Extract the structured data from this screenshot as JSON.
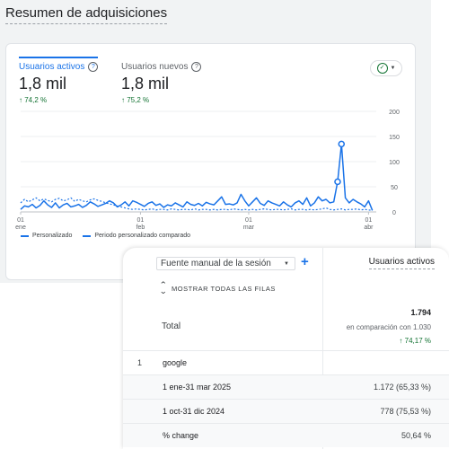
{
  "page_title": "Resumen de adquisiciones",
  "metrics": [
    {
      "label": "Usuarios activos",
      "value": "1,8 mil",
      "change": "↑ 74,2 %"
    },
    {
      "label": "Usuarios nuevos",
      "value": "1,8 mil",
      "change": "↑ 75,2 %"
    }
  ],
  "chart_data": {
    "type": "line",
    "x_tick_labels": [
      [
        "01",
        "ene"
      ],
      [
        "01",
        "feb"
      ],
      [
        "01",
        "mar"
      ],
      [
        "01",
        "abr"
      ]
    ],
    "x_tick_positions": [
      0,
      31,
      59,
      90
    ],
    "y_ticks": [
      0,
      50,
      100,
      150,
      200
    ],
    "ylim": [
      0,
      200
    ],
    "xlim": [
      0,
      92
    ],
    "grid": true,
    "legend_position": "bottom-left",
    "series": [
      {
        "name": "Personalizado",
        "style": "solid",
        "color": "#1a73e8",
        "values": [
          5,
          12,
          10,
          15,
          8,
          13,
          22,
          14,
          9,
          18,
          8,
          14,
          17,
          10,
          12,
          15,
          9,
          13,
          20,
          16,
          11,
          14,
          17,
          22,
          18,
          10,
          14,
          20,
          12,
          22,
          19,
          15,
          11,
          17,
          20,
          13,
          16,
          9,
          14,
          12,
          18,
          14,
          10,
          20,
          15,
          13,
          17,
          12,
          19,
          16,
          14,
          22,
          30,
          15,
          16,
          14,
          18,
          35,
          22,
          12,
          20,
          28,
          17,
          13,
          22,
          18,
          15,
          12,
          20,
          14,
          10,
          18,
          22,
          15,
          28,
          12,
          18,
          30,
          22,
          25,
          18,
          20,
          60,
          135,
          28,
          18,
          25,
          20,
          16,
          10,
          22,
          3
        ]
      },
      {
        "name": "Periodo personalizado comparado",
        "style": "dashed",
        "color": "#1a73e8",
        "values": [
          18,
          25,
          20,
          24,
          28,
          22,
          26,
          23,
          20,
          25,
          27,
          22,
          24,
          28,
          21,
          25,
          22,
          20,
          24,
          26,
          23,
          21,
          18,
          16,
          14,
          12,
          10,
          8,
          6,
          5,
          6,
          5,
          4,
          5,
          6,
          4,
          5,
          5,
          4,
          6,
          5,
          4,
          5,
          5,
          4,
          6,
          4,
          5,
          5,
          4,
          5,
          4,
          5,
          5,
          4,
          6,
          5,
          4,
          5,
          4,
          5,
          4,
          5,
          6,
          5,
          4,
          5,
          5,
          4,
          5,
          6,
          4,
          5,
          5,
          4,
          5,
          4,
          5,
          6,
          8,
          5,
          4,
          5,
          6,
          4,
          5,
          5,
          6,
          4,
          5,
          4,
          3
        ]
      }
    ],
    "highlighted_points": [
      {
        "x": 82,
        "y": 60
      },
      {
        "x": 83,
        "y": 135
      }
    ]
  },
  "table": {
    "dimension_select": "Fuente manual de la sesión",
    "column_header": "Usuarios activos",
    "show_rows_label": "MOSTRAR TODAS LAS FILAS",
    "total": {
      "label": "Total",
      "value": "1.794",
      "compare": "en comparación con 1.030",
      "change": "↑ 74,17 %"
    },
    "rows": [
      {
        "index": "1",
        "name": "google",
        "value": ""
      },
      {
        "index": "",
        "name": "1 ene-31 mar 2025",
        "value": "1.172 (65,33 %)"
      },
      {
        "index": "",
        "name": "1 oct-31 dic 2024",
        "value": "778 (75,53 %)"
      },
      {
        "index": "",
        "name": "% change",
        "value": "50,64 %"
      }
    ]
  },
  "colors": {
    "accent": "#1a73e8",
    "positive": "#137333"
  }
}
